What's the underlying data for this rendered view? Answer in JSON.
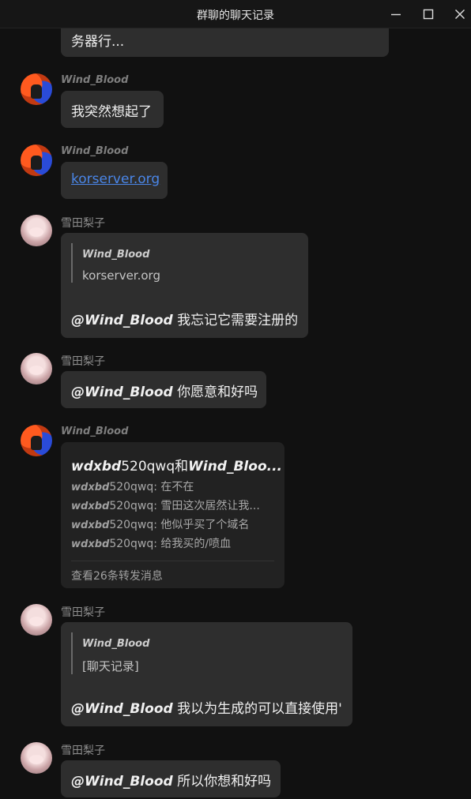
{
  "window": {
    "title": "群聊的聊天记录"
  },
  "messages": {
    "m0": {
      "text": "务器行..."
    },
    "m1": {
      "sender": "Wind_Blood",
      "text": "我突然想起了"
    },
    "m2": {
      "sender": "Wind_Blood",
      "link": "korserver.org"
    },
    "m3": {
      "sender": "雪田梨子",
      "quote_author": "Wind_Blood",
      "quote_text": "korserver.org",
      "mention": "@Wind_Blood",
      "text": " 我忘记它需要注册的"
    },
    "m4": {
      "sender": "雪田梨子",
      "mention": "@Wind_Blood",
      "text": " 你愿意和好吗"
    },
    "m5": {
      "sender": "Wind_Blood",
      "forward": {
        "title_a": "wdxbd",
        "title_b": "520qwq和",
        "title_c": "Wind_Bloo...",
        "lines": [
          {
            "name_a": "wdxbd",
            "name_b": "520qwq",
            "text": ": 在不在"
          },
          {
            "name_a": "wdxbd",
            "name_b": "520qwq",
            "text": ": 雪田这次居然让我..."
          },
          {
            "name_a": "wdxbd",
            "name_b": "520qwq",
            "text": ": 他似乎买了个域名"
          },
          {
            "name_a": "wdxbd",
            "name_b": "520qwq",
            "text": ": 给我买的/喷血"
          }
        ],
        "footer": "查看26条转发消息"
      }
    },
    "m6": {
      "sender": "雪田梨子",
      "quote_author": "Wind_Blood",
      "quote_text": "[聊天记录]",
      "mention": "@Wind_Blood",
      "text": " 我以为生成的可以直接使用'"
    },
    "m7": {
      "sender": "雪田梨子",
      "mention": "@Wind_Blood",
      "text": " 所以你想和好吗"
    }
  }
}
